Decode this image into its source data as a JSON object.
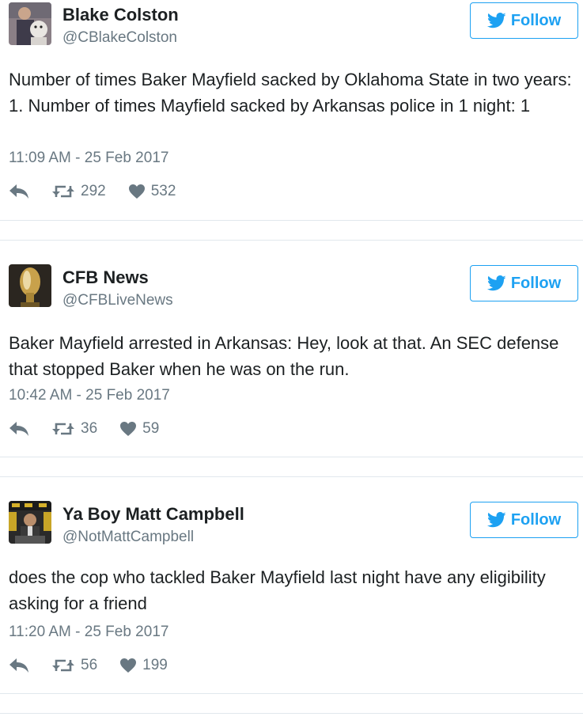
{
  "tweets": [
    {
      "name": "Blake Colston",
      "handle": "@CBlakeColston",
      "follow_label": "Follow",
      "text": "Number of times Baker Mayfield sacked by Oklahoma State in two years: 1. Number of times Mayfield sacked by Arkansas police in 1 night: 1",
      "timestamp": "11:09 AM - 25 Feb 2017",
      "retweets": "292",
      "likes": "532"
    },
    {
      "name": "CFB News",
      "handle": "@CFBLiveNews",
      "follow_label": "Follow",
      "text": "Baker Mayfield arrested in Arkansas: Hey, look at that. An SEC defense that stopped Baker when he was on the run.",
      "timestamp": "10:42 AM - 25 Feb 2017",
      "retweets": "36",
      "likes": "59"
    },
    {
      "name": "Ya Boy Matt Campbell",
      "handle": "@NotMattCampbell",
      "follow_label": "Follow",
      "text": "does the cop who tackled Baker Mayfield last night have any eligibility asking for a friend",
      "timestamp": "11:20 AM - 25 Feb 2017",
      "retweets": "56",
      "likes": "199"
    }
  ],
  "icons": {
    "follow": "twitter-bird-icon",
    "reply": "reply-icon",
    "retweet": "retweet-icon",
    "like": "heart-icon"
  },
  "colors": {
    "accent": "#1da1f2",
    "text": "#1c2022",
    "muted": "#697882",
    "border": "#e1e8ed"
  }
}
